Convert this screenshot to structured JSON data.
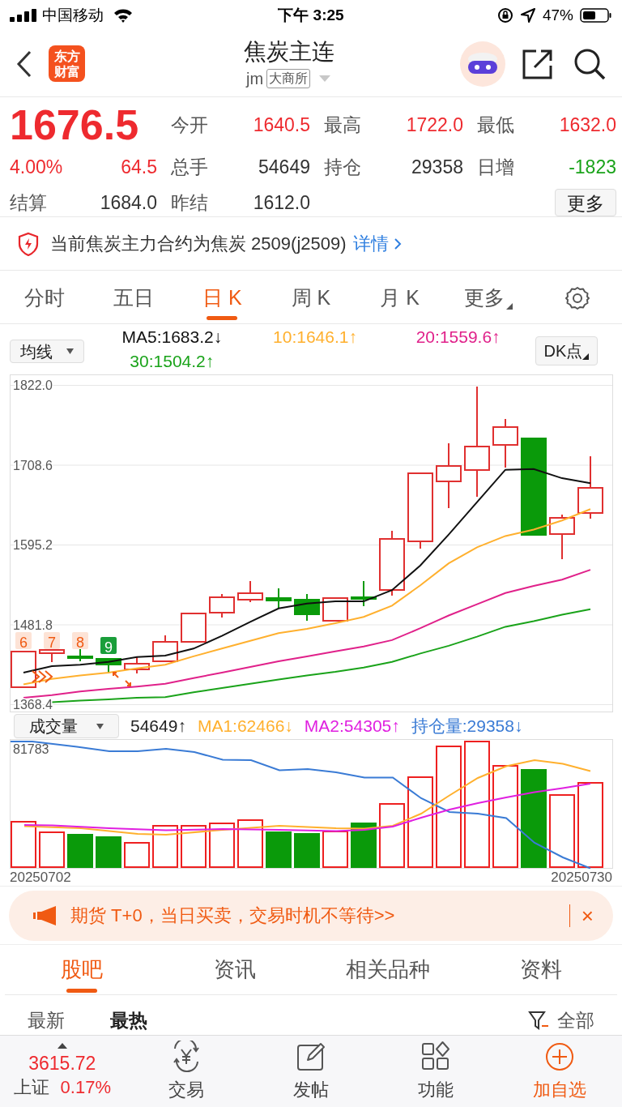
{
  "status_bar": {
    "carrier": "中国移动",
    "time": "下午 3:25",
    "battery": "47%"
  },
  "header": {
    "logo_lines": [
      "东方",
      "财富"
    ],
    "title": "焦炭主连",
    "code": "jm",
    "exchange": "大商所"
  },
  "quote": {
    "price": "1676.5",
    "change_pct": "4.00%",
    "change": "64.5",
    "color": "#ee2a2f",
    "rows": [
      [
        {
          "label": "今开",
          "value": "1640.5",
          "color": "#ee2a2f"
        },
        {
          "label": "最高",
          "value": "1722.0",
          "color": "#ee2a2f"
        },
        {
          "label": "最低",
          "value": "1632.0",
          "color": "#ee2a2f"
        }
      ],
      [
        {
          "label": "总手",
          "value": "54649",
          "color": "#333333"
        },
        {
          "label": "持仓",
          "value": "29358",
          "color": "#333333"
        },
        {
          "label": "日增",
          "value": "-1823",
          "color": "#1aa31a"
        }
      ]
    ],
    "settle": {
      "label": "结算",
      "value": "1684.0"
    },
    "prev_settle": {
      "label": "昨结",
      "value": "1612.0"
    },
    "more_button": "更多"
  },
  "notice": {
    "text": "当前焦炭主力合约为焦炭 2509(j2509)",
    "link": "详情"
  },
  "period_tabs": [
    {
      "label": "分时",
      "selected": false,
      "dropdown": false
    },
    {
      "label": "五日",
      "selected": false,
      "dropdown": false
    },
    {
      "label": "日 K",
      "selected": true,
      "dropdown": false
    },
    {
      "label": "周 K",
      "selected": false,
      "dropdown": false
    },
    {
      "label": "月 K",
      "selected": false,
      "dropdown": false
    },
    {
      "label": "更多",
      "selected": false,
      "dropdown": true
    }
  ],
  "ma_legend": {
    "selector": "均线",
    "readings": [
      ":1683.2↓",
      ":1646.1↑",
      ":1559.6↑",
      ":1504.2↑"
    ],
    "dk_button": "DK点"
  },
  "chart_data": {
    "type": "line",
    "ylim": [
      1358.6,
      1837.5
    ],
    "grid": true,
    "yticks": [
      {
        "value": 1822.0,
        "label": "1822.0"
      },
      {
        "value": 1708.6,
        "label": "1708.6"
      },
      {
        "value": 1595.2,
        "label": "1595.2"
      },
      {
        "value": 1481.8,
        "label": "1481.8"
      },
      {
        "value": 1368.4,
        "label": "1368.4"
      }
    ],
    "series": [
      {
        "name": "MA5",
        "color": "#111111",
        "values": [
          1414,
          1423,
          1425,
          1429,
          1436,
          1438,
          1448,
          1466,
          1486,
          1505,
          1512,
          1515,
          1515,
          1531,
          1566,
          1610,
          1656,
          1702,
          1703,
          1690,
          1683
        ]
      },
      {
        "name": "10",
        "color": "#ffb02e",
        "values": [
          1397,
          1405,
          1410,
          1414,
          1420,
          1425,
          1437,
          1448,
          1459,
          1470,
          1476,
          1484,
          1493,
          1509,
          1538,
          1569,
          1592,
          1608,
          1617,
          1630,
          1646
        ]
      },
      {
        "name": "20",
        "color": "#e0218a",
        "values": [
          1378,
          1382,
          1387,
          1391,
          1394,
          1398,
          1406,
          1414,
          1422,
          1430,
          1437,
          1444,
          1451,
          1460,
          1477,
          1495,
          1511,
          1527,
          1537,
          1546,
          1560
        ]
      },
      {
        "name": "30",
        "color": "#1aa31a",
        "values": [
          null,
          1372,
          1374,
          1376,
          1378,
          1379,
          1386,
          1392,
          1398,
          1404,
          1410,
          1415,
          1421,
          1429,
          1441,
          1452,
          1465,
          1479,
          1487,
          1496,
          1504
        ]
      }
    ]
  },
  "sequence_marks": [
    {
      "label": "6",
      "color": "#f05a12"
    },
    {
      "label": "7",
      "color": "#f05a12"
    },
    {
      "label": "8",
      "color": "#f05a12"
    },
    {
      "label": "9",
      "color": "#1a9e3a"
    }
  ],
  "volume_legend": {
    "selector": "成交量",
    "items": [
      {
        "label": "54649↑",
        "color": "#222222"
      },
      {
        "label": "MA1:62466↓",
        "color": "#ffb02e"
      },
      {
        "label": "MA2:54305↑",
        "color": "#e020e0"
      },
      {
        "label": "持仓量:29358↓",
        "color": "#3a7bd5"
      }
    ]
  },
  "volume_axis": "81783",
  "date_start": "20250702",
  "date_end": "20250730",
  "banner": {
    "text": "期货 T+0，当日买卖，交易时机不等待>>",
    "close": "×"
  },
  "section_tabs": [
    {
      "label": "股吧",
      "selected": true
    },
    {
      "label": "资讯",
      "selected": false
    },
    {
      "label": "相关品种",
      "selected": false
    },
    {
      "label": "资料",
      "selected": false
    }
  ],
  "sort": {
    "options": [
      {
        "label": "最新",
        "selected": false
      },
      {
        "label": "最热",
        "selected": true
      }
    ],
    "filter": "全部"
  },
  "bottom_bar": {
    "index_value": "3615.72",
    "index_name": "上证",
    "index_change": "0.17%",
    "items": [
      {
        "label": "交易",
        "kind": "trade",
        "highlighted": false
      },
      {
        "label": "发帖",
        "kind": "post",
        "highlighted": false
      },
      {
        "label": "功能",
        "kind": "apps",
        "highlighted": false
      },
      {
        "label": "加自选",
        "kind": "add",
        "highlighted": true
      }
    ]
  }
}
